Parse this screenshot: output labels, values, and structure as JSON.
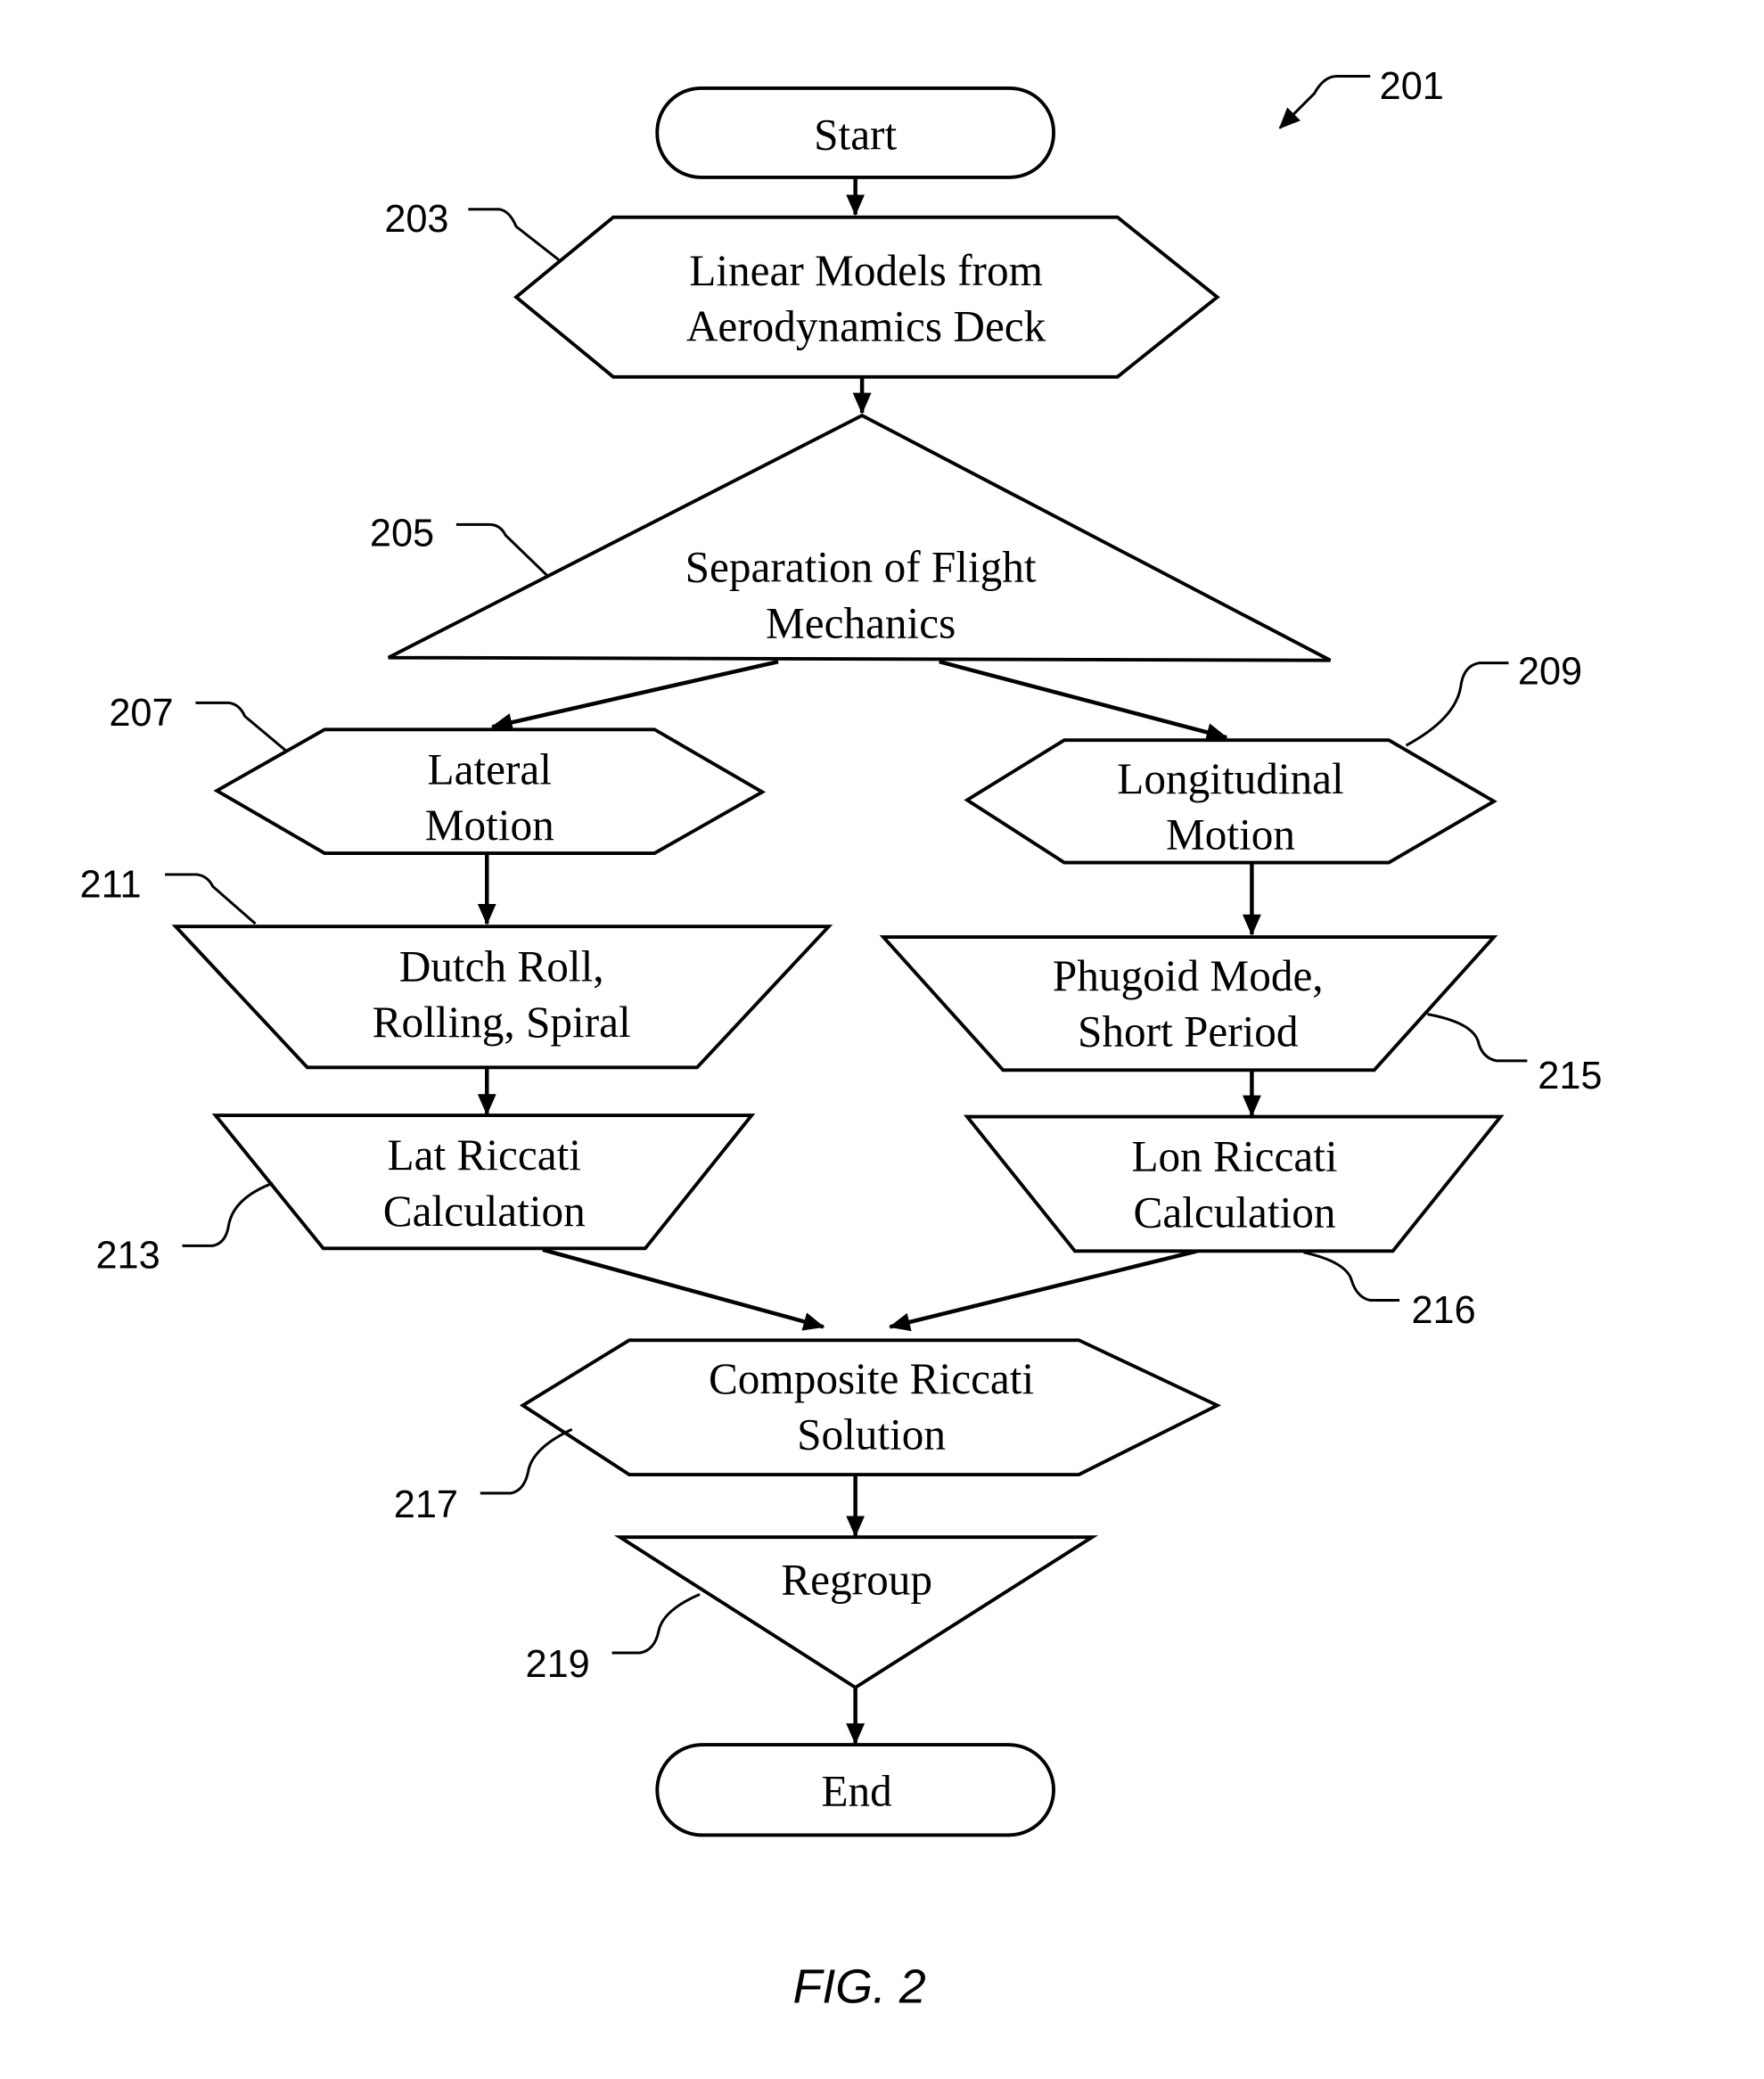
{
  "figure": {
    "caption": "FIG. 2",
    "reference": "201"
  },
  "nodes": {
    "start": {
      "lines": [
        "Start"
      ],
      "shape": "terminator"
    },
    "linear_models": {
      "ref": "203",
      "lines": [
        "Linear Models from",
        "Aerodynamics Deck"
      ],
      "shape": "hexagon"
    },
    "separation": {
      "ref": "205",
      "lines": [
        "Separation of Flight",
        "Mechanics"
      ],
      "shape": "triangle-up"
    },
    "lateral_motion": {
      "ref": "207",
      "lines": [
        "Lateral",
        "Motion"
      ],
      "shape": "hexagon"
    },
    "longitudinal_motion": {
      "ref": "209",
      "lines": [
        "Longitudinal",
        "Motion"
      ],
      "shape": "hexagon"
    },
    "dutch_roll": {
      "ref": "211",
      "lines": [
        "Dutch Roll,",
        "Rolling, Spiral"
      ],
      "shape": "trapezoid"
    },
    "lat_riccati": {
      "ref": "213",
      "lines": [
        "Lat Riccati",
        "Calculation"
      ],
      "shape": "trapezoid"
    },
    "phugoid": {
      "ref": "215",
      "lines": [
        "Phugoid Mode,",
        "Short Period"
      ],
      "shape": "trapezoid"
    },
    "lon_riccati": {
      "ref": "216",
      "lines": [
        "Lon Riccati",
        "Calculation"
      ],
      "shape": "trapezoid"
    },
    "composite_riccati": {
      "ref": "217",
      "lines": [
        "Composite Riccati",
        "Solution"
      ],
      "shape": "hexagon"
    },
    "regroup": {
      "ref": "219",
      "lines": [
        "Regroup"
      ],
      "shape": "triangle-down"
    },
    "end": {
      "lines": [
        "End"
      ],
      "shape": "terminator"
    }
  },
  "edges": [
    [
      "start",
      "linear_models"
    ],
    [
      "linear_models",
      "separation"
    ],
    [
      "separation",
      "lateral_motion"
    ],
    [
      "separation",
      "longitudinal_motion"
    ],
    [
      "lateral_motion",
      "dutch_roll"
    ],
    [
      "dutch_roll",
      "lat_riccati"
    ],
    [
      "longitudinal_motion",
      "phugoid"
    ],
    [
      "phugoid",
      "lon_riccati"
    ],
    [
      "lat_riccati",
      "composite_riccati"
    ],
    [
      "lon_riccati",
      "composite_riccati"
    ],
    [
      "composite_riccati",
      "regroup"
    ],
    [
      "regroup",
      "end"
    ]
  ]
}
